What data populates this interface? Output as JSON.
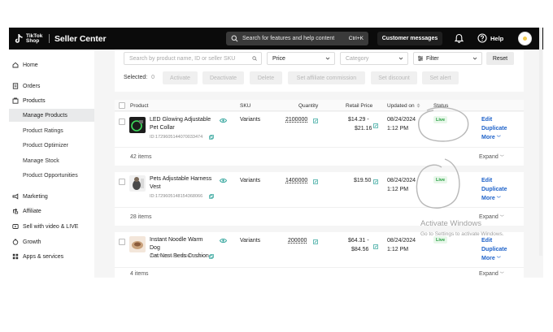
{
  "topbar": {
    "logo_text": "TikTok Shop",
    "app_title": "Seller Center",
    "search_placeholder": "Search for features and help content",
    "search_shortcut": "Ctrl+K",
    "customer_messages": "Customer messages",
    "help": "Help"
  },
  "sidebar": {
    "items": [
      {
        "label": "Home",
        "icon": "home-icon"
      },
      {
        "label": "Orders",
        "icon": "orders-icon"
      },
      {
        "label": "Products",
        "icon": "products-icon"
      },
      {
        "label": "Marketing",
        "icon": "megaphone-icon"
      },
      {
        "label": "Affiliate",
        "icon": "affiliate-icon"
      },
      {
        "label": "Sell with video & LIVE",
        "icon": "video-icon"
      },
      {
        "label": "Growth",
        "icon": "growth-icon"
      },
      {
        "label": "Apps & services",
        "icon": "apps-icon"
      }
    ],
    "products_sub": [
      "Manage Products",
      "Product Ratings",
      "Product Optimizer",
      "Manage Stock",
      "Product Opportunities"
    ],
    "active_sub": "Manage Products"
  },
  "filters": {
    "search_placeholder": "Search by product name, ID or seller SKU",
    "price": "Price",
    "category": "Category",
    "filter": "Filter",
    "reset": "Reset",
    "selected_label": "Selected:",
    "selected_count": "0",
    "bulk_actions": [
      "Activate",
      "Deactivate",
      "Delete",
      "Set affiliate commission",
      "Set discount",
      "Set alert"
    ]
  },
  "table": {
    "headers": {
      "product": "Product",
      "sku": "SKU",
      "quantity": "Quantity",
      "retail_price": "Retail Price",
      "updated_on": "Updated on",
      "status": "Status"
    },
    "rows": [
      {
        "name_line1": "LED Glowing Adjustable",
        "name_line2": "Pet Collar",
        "id": "ID:1729605144070033474",
        "sku": "Variants",
        "quantity": "2100000",
        "price_line1": "$14.29 -",
        "price_line2": "$21.16",
        "date": "08/24/2024",
        "time": "1:12 PM",
        "status": "Live",
        "items": "42 items"
      },
      {
        "name_line1": "Pets Adjustable Harness",
        "name_line2": "Vest",
        "id": "ID:1729605148154368066",
        "sku": "Variants",
        "quantity": "1400000",
        "price_line1": "$19.50",
        "price_line2": "",
        "date": "08/24/2024",
        "time": "1:12 PM",
        "status": "Live",
        "items": "28 items"
      },
      {
        "name_line1": "Instant Noodle Warm Dog",
        "name_line2": "Cat Nest Beds Cushion",
        "id": "ID:1729605137869873730",
        "sku": "Variants",
        "quantity": "200000",
        "price_line1": "$64.31 -",
        "price_line2": "$84.56",
        "date": "08/24/2024",
        "time": "1:12 PM",
        "status": "Live",
        "items": "4 items"
      }
    ],
    "actions": {
      "edit": "Edit",
      "duplicate": "Duplicate",
      "more": "More"
    },
    "expand": "Expand"
  },
  "watermark": {
    "line1": "Activate Windows",
    "line2": "Go to Settings to activate Windows."
  }
}
